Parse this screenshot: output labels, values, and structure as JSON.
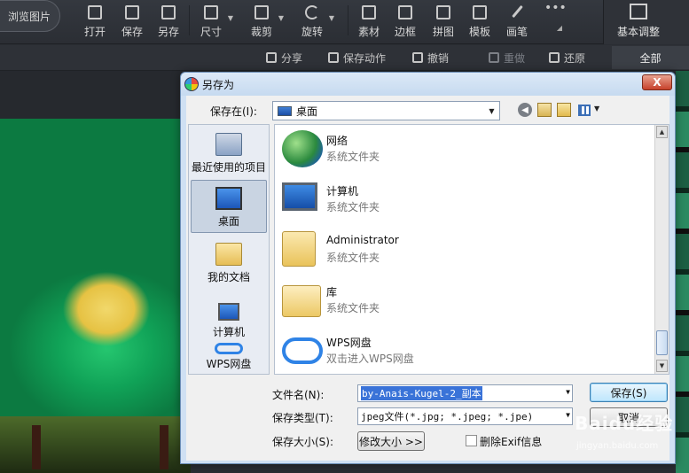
{
  "app": {
    "browse_label": "浏览图片",
    "tools": [
      {
        "label": "打开",
        "icon": "open-icon"
      },
      {
        "label": "保存",
        "icon": "save-icon"
      },
      {
        "label": "另存",
        "icon": "save-as-icon"
      },
      {
        "label": "尺寸",
        "icon": "resize-icon"
      },
      {
        "label": "裁剪",
        "icon": "crop-icon"
      },
      {
        "label": "旋转",
        "icon": "rotate-icon"
      },
      {
        "label": "素材",
        "icon": "material-icon"
      },
      {
        "label": "边框",
        "icon": "border-icon"
      },
      {
        "label": "拼图",
        "icon": "collage-icon"
      },
      {
        "label": "模板",
        "icon": "template-icon"
      },
      {
        "label": "画笔",
        "icon": "brush-icon"
      },
      {
        "label": "",
        "icon": "more-icon"
      }
    ],
    "basic_adjust_label": "基本调整",
    "sub_actions": {
      "share": "分享",
      "save_action": "保存动作",
      "undo": "撤销",
      "redo": "重做",
      "restore": "还原"
    },
    "all_tab": "全部"
  },
  "dialog": {
    "title": "另存为",
    "close_label": "X",
    "save_in_label": "保存在(I):",
    "location_value": "桌面",
    "places": [
      {
        "label": "最近使用的项目",
        "icon": "recent-items-icon"
      },
      {
        "label": "桌面",
        "icon": "desktop-icon"
      },
      {
        "label": "我的文档",
        "icon": "documents-icon"
      },
      {
        "label": "计算机",
        "icon": "computer-icon"
      },
      {
        "label": "WPS网盘",
        "icon": "cloud-icon"
      }
    ],
    "items": [
      {
        "name": "网络",
        "desc": "系统文件夹",
        "icon": "network-icon"
      },
      {
        "name": "计算机",
        "desc": "系统文件夹",
        "icon": "computer-icon"
      },
      {
        "name": "Administrator",
        "desc": "系统文件夹",
        "icon": "user-folder-icon"
      },
      {
        "name": "库",
        "desc": "系统文件夹",
        "icon": "library-icon"
      },
      {
        "name": "WPS网盘",
        "desc": "双击进入WPS网盘",
        "icon": "cloud-icon"
      }
    ],
    "filename_label": "文件名(N):",
    "filename_value": "by-Anais-Kugel-2_副本",
    "filetype_label": "保存类型(T):",
    "filetype_value": "jpeg文件(*.jpg; *.jpeg; *.jpe)",
    "filesize_label": "保存大小(S):",
    "resize_button": "修改大小 >>",
    "exif_label": "删除Exif信息",
    "exif_checked": false,
    "save_button": "保存(S)",
    "cancel_button": "取消"
  },
  "watermark": {
    "logo": "Baidu经验",
    "url": "jingyan.baidu.com"
  }
}
